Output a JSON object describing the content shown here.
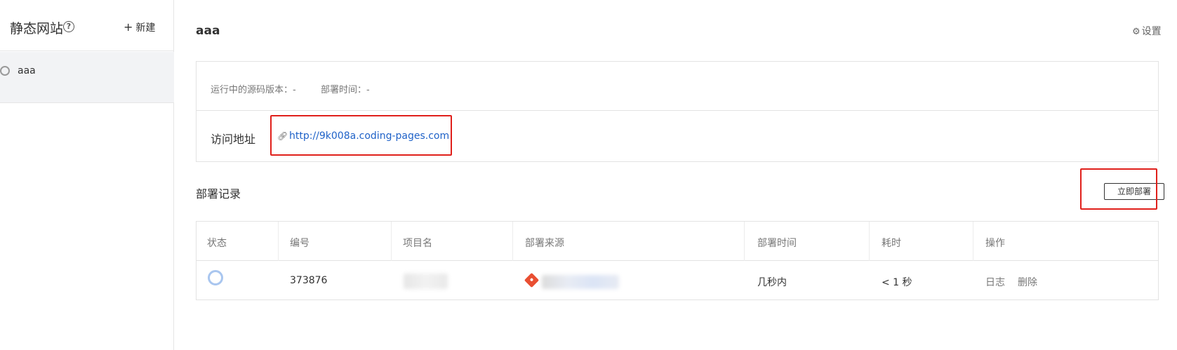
{
  "sidebar": {
    "title": "静态网站",
    "help_icon": "?",
    "new_button_label": "新建",
    "items": [
      {
        "label": "aaa"
      }
    ]
  },
  "main": {
    "title": "aaa",
    "settings_label": "设置",
    "source_version_label": "运行中的源码版本：-",
    "deploy_time_label": "部署时间：-",
    "visit_label": "访问地址",
    "visit_url": "http://9k008a.coding-pages.com",
    "records_title": "部署记录",
    "deploy_now_label": "立即部署"
  },
  "table": {
    "headers": [
      "状态",
      "编号",
      "项目名",
      "部署来源",
      "部署时间",
      "耗时",
      "操作"
    ],
    "rows": [
      {
        "id": "373876",
        "time": "几秒内",
        "duration": "< 1 秒",
        "actions": [
          "日志",
          "删除"
        ]
      }
    ]
  },
  "colors": {
    "link": "#1f62c8",
    "highlight_border": "#e0201b",
    "git_icon": "#e94f32",
    "status_ring": "#a9c6ef"
  },
  "icons": [
    "help-icon",
    "plus-icon",
    "gear-icon",
    "link-icon",
    "git-icon",
    "status-circle-icon"
  ]
}
